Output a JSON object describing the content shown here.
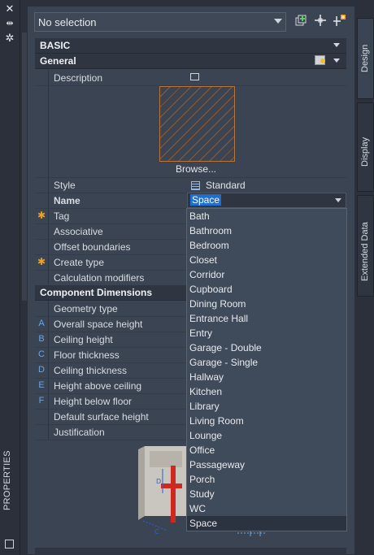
{
  "selector": {
    "value": "No selection"
  },
  "sections": {
    "basic": "BASIC",
    "general": "General",
    "component_dimensions": "Component Dimensions"
  },
  "general_rows": [
    {
      "name": "Description"
    },
    {
      "name": "Style",
      "value": "Standard"
    },
    {
      "name": "Name",
      "value": "Space"
    },
    {
      "name": "Tag"
    },
    {
      "name": "Associative"
    },
    {
      "name": "Offset boundaries"
    },
    {
      "name": "Create type"
    },
    {
      "name": "Calculation modifiers"
    }
  ],
  "browse_label": "Browse...",
  "dimension_rows": [
    {
      "mark": "",
      "name": "Geometry type"
    },
    {
      "mark": "A",
      "name": "Overall space height"
    },
    {
      "mark": "B",
      "name": "Ceiling height"
    },
    {
      "mark": "C",
      "name": "Floor thickness"
    },
    {
      "mark": "D",
      "name": "Ceiling thickness"
    },
    {
      "mark": "E",
      "name": "Height above ceiling"
    },
    {
      "mark": "F",
      "name": "Height below floor"
    },
    {
      "mark": "",
      "name": "Default surface height"
    },
    {
      "mark": "",
      "name": "Justification"
    }
  ],
  "name_options": [
    "Bath",
    "Bathroom",
    "Bedroom",
    "Closet",
    "Corridor",
    "Cupboard",
    "Dining Room",
    "Entrance Hall",
    "Entry",
    "Garage - Double",
    "Garage - Single",
    "Hallway",
    "Kitchen",
    "Library",
    "Living Room",
    "Lounge",
    "Office",
    "Passageway",
    "Porch",
    "Study",
    "WC",
    "Space"
  ],
  "selected_option": "Space",
  "tabs": [
    "Design",
    "Display",
    "Extended Data"
  ],
  "palette_label": "PROPERTIES",
  "colors": {
    "selection": "#1f6fcf",
    "hatch": "#b8743a",
    "tag_marker": "#f0a020",
    "dim_marker": "#6aa6e6"
  }
}
